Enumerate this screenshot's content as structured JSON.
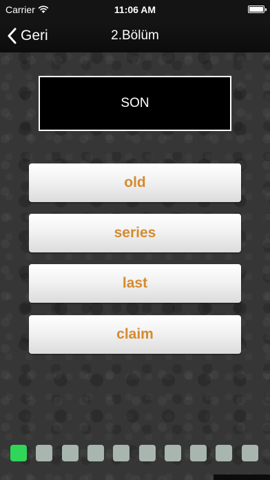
{
  "status_bar": {
    "carrier": "Carrier",
    "time": "11:06 AM"
  },
  "nav": {
    "back_label": "Geri",
    "title": "2.Bölüm"
  },
  "question": {
    "word": "SON"
  },
  "answers": [
    {
      "label": "old"
    },
    {
      "label": "series"
    },
    {
      "label": "last"
    },
    {
      "label": "claim"
    }
  ],
  "progress": {
    "total": 10,
    "current": 1,
    "active_color": "#2fd65a",
    "inactive_color": "#a9b6b0"
  },
  "colors": {
    "answer_text": "#d68a2e",
    "background": "#363636"
  }
}
